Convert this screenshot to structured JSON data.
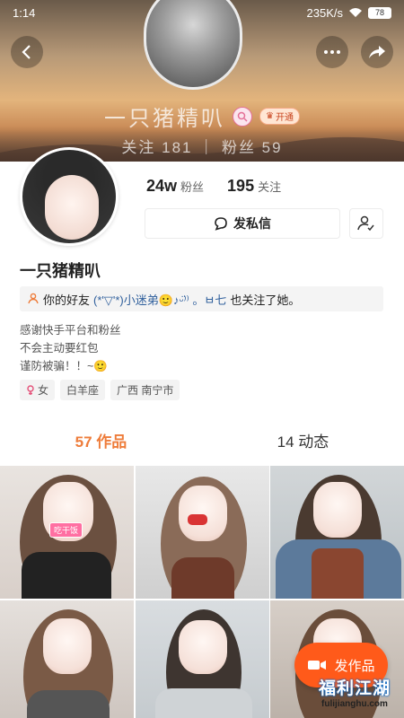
{
  "status": {
    "time": "1:14",
    "speed": "235K/s",
    "battery": "78"
  },
  "header": {
    "name": "一只猪精叭",
    "vip_label": "开通",
    "stats_text": "关注 181 ｜ 粉丝 59"
  },
  "profile": {
    "counts": [
      {
        "num": "24w",
        "label": "粉丝"
      },
      {
        "num": "195",
        "label": "关注"
      }
    ],
    "message_label": "发私信",
    "name": "一只猪精叭",
    "mutual": {
      "prefix": "你的好友",
      "friend": "(*'▽'*)小迷弟🙂♪ᵕ̈⁾⁾ 。ㅂ七",
      "suffix": "也关注了她。"
    },
    "bio": [
      "感谢快手平台和粉丝",
      "不会主动要红包",
      "谨防被骗！！~🙂"
    ],
    "tags": [
      "女",
      "白羊座",
      "广西 南宁市"
    ]
  },
  "tabs": [
    {
      "label": "57 作品"
    },
    {
      "label": "14 动态"
    }
  ],
  "grid": {
    "sticker_text": "吃干饭"
  },
  "fab_label": "发作品",
  "watermark": {
    "big": "福利江湖",
    "small": "fulijianghu.com"
  },
  "colors": {
    "accent": "#ee7c3a",
    "fab": "#ff5a1a",
    "link": "#2f5f9c"
  }
}
